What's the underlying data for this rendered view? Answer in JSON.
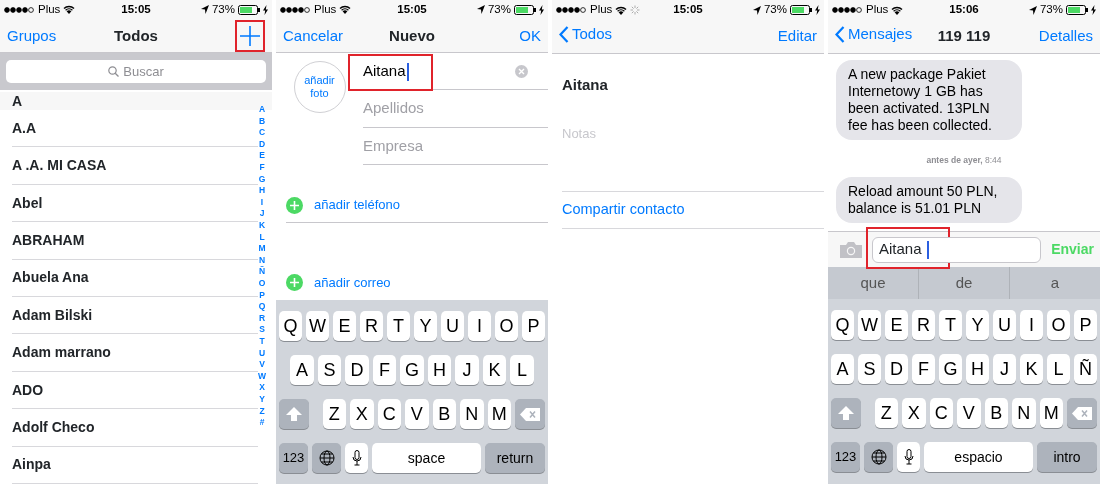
{
  "panels": [
    {
      "kind": "contacts_list",
      "status_bar": {
        "carrier": "Plus",
        "time": "15:05",
        "battery": "73%",
        "loading": false
      },
      "nav": {
        "left": "Grupos",
        "title": "Todos",
        "back": false,
        "add_button": {
          "highlighted": true
        }
      },
      "search": {
        "placeholder": "Buscar"
      },
      "section": {
        "header": "A",
        "contacts": [
          "A.A",
          "A .A. MI CASA",
          "Abel",
          "ABRAHAM",
          "Abuela Ana",
          "Adam Bilski",
          "Adam marrano",
          "ADO",
          "Adolf Checo",
          "Ainpa"
        ]
      },
      "index": [
        "A",
        "B",
        "C",
        "D",
        "E",
        "F",
        "G",
        "H",
        "I",
        "J",
        "K",
        "L",
        "M",
        "N",
        "Ñ",
        "O",
        "P",
        "Q",
        "R",
        "S",
        "T",
        "U",
        "V",
        "W",
        "X",
        "Y",
        "Z",
        "#"
      ]
    },
    {
      "kind": "new_contact",
      "status_bar": {
        "carrier": "Plus",
        "time": "15:05",
        "battery": "73%",
        "loading": false
      },
      "nav": {
        "left": "Cancelar",
        "title": "Nuevo",
        "right": "OK",
        "back": false
      },
      "photo_button": "añadir foto",
      "fields": [
        {
          "value": "Aitana",
          "focused": true,
          "highlighted": true
        },
        {
          "placeholder": "Apellidos",
          "focused": false,
          "highlighted": false
        },
        {
          "placeholder": "Empresa",
          "focused": false,
          "highlighted": false
        }
      ],
      "add_rows": [
        "añadir teléfono",
        "añadir correo"
      ],
      "keyboard": {
        "rows": [
          [
            "Q",
            "W",
            "E",
            "R",
            "T",
            "Y",
            "U",
            "I",
            "O",
            "P"
          ],
          [
            "A",
            "S",
            "D",
            "F",
            "G",
            "H",
            "J",
            "K",
            "L"
          ],
          [
            "Z",
            "X",
            "C",
            "V",
            "B",
            "N",
            "M"
          ]
        ],
        "numbers_key": "123",
        "space_key": "space",
        "return_key": "return"
      }
    },
    {
      "kind": "contact_detail",
      "status_bar": {
        "carrier": "Plus",
        "time": "15:05",
        "battery": "73%",
        "loading": true
      },
      "nav": {
        "left": "Todos",
        "right": "Editar",
        "back": true
      },
      "name": "Aitana",
      "notes_placeholder": "Notas",
      "action": "Compartir contacto"
    },
    {
      "kind": "conversation",
      "status_bar": {
        "carrier": "Plus",
        "time": "15:06",
        "battery": "73%",
        "loading": false
      },
      "nav": {
        "left": "Mensajes",
        "title": "119 119",
        "right": "Detalles",
        "back": true
      },
      "messages": [
        {
          "kind": "bubble",
          "text": "A new package Pakiet Internetowy 1 GB has been activated. 13PLN fee has been collected."
        },
        {
          "kind": "timestamp",
          "text": "**antes de ayer,** 8:44"
        },
        {
          "kind": "bubble",
          "text": "Reload amount 50 PLN, balance is 51.01 PLN"
        }
      ],
      "compose": {
        "value": "Aitana",
        "focused": true,
        "highlighted": true,
        "send": "Enviar"
      },
      "suggestions": [
        "que",
        "de",
        "a"
      ],
      "keyboard": {
        "rows": [
          [
            "Q",
            "W",
            "E",
            "R",
            "T",
            "Y",
            "U",
            "I",
            "O",
            "P"
          ],
          [
            "A",
            "S",
            "D",
            "F",
            "G",
            "H",
            "J",
            "K",
            "L",
            "Ñ"
          ],
          [
            "Z",
            "X",
            "C",
            "V",
            "B",
            "N",
            "M"
          ]
        ],
        "numbers_key": "123",
        "space_key": "espacio",
        "return_key": "intro"
      }
    }
  ]
}
